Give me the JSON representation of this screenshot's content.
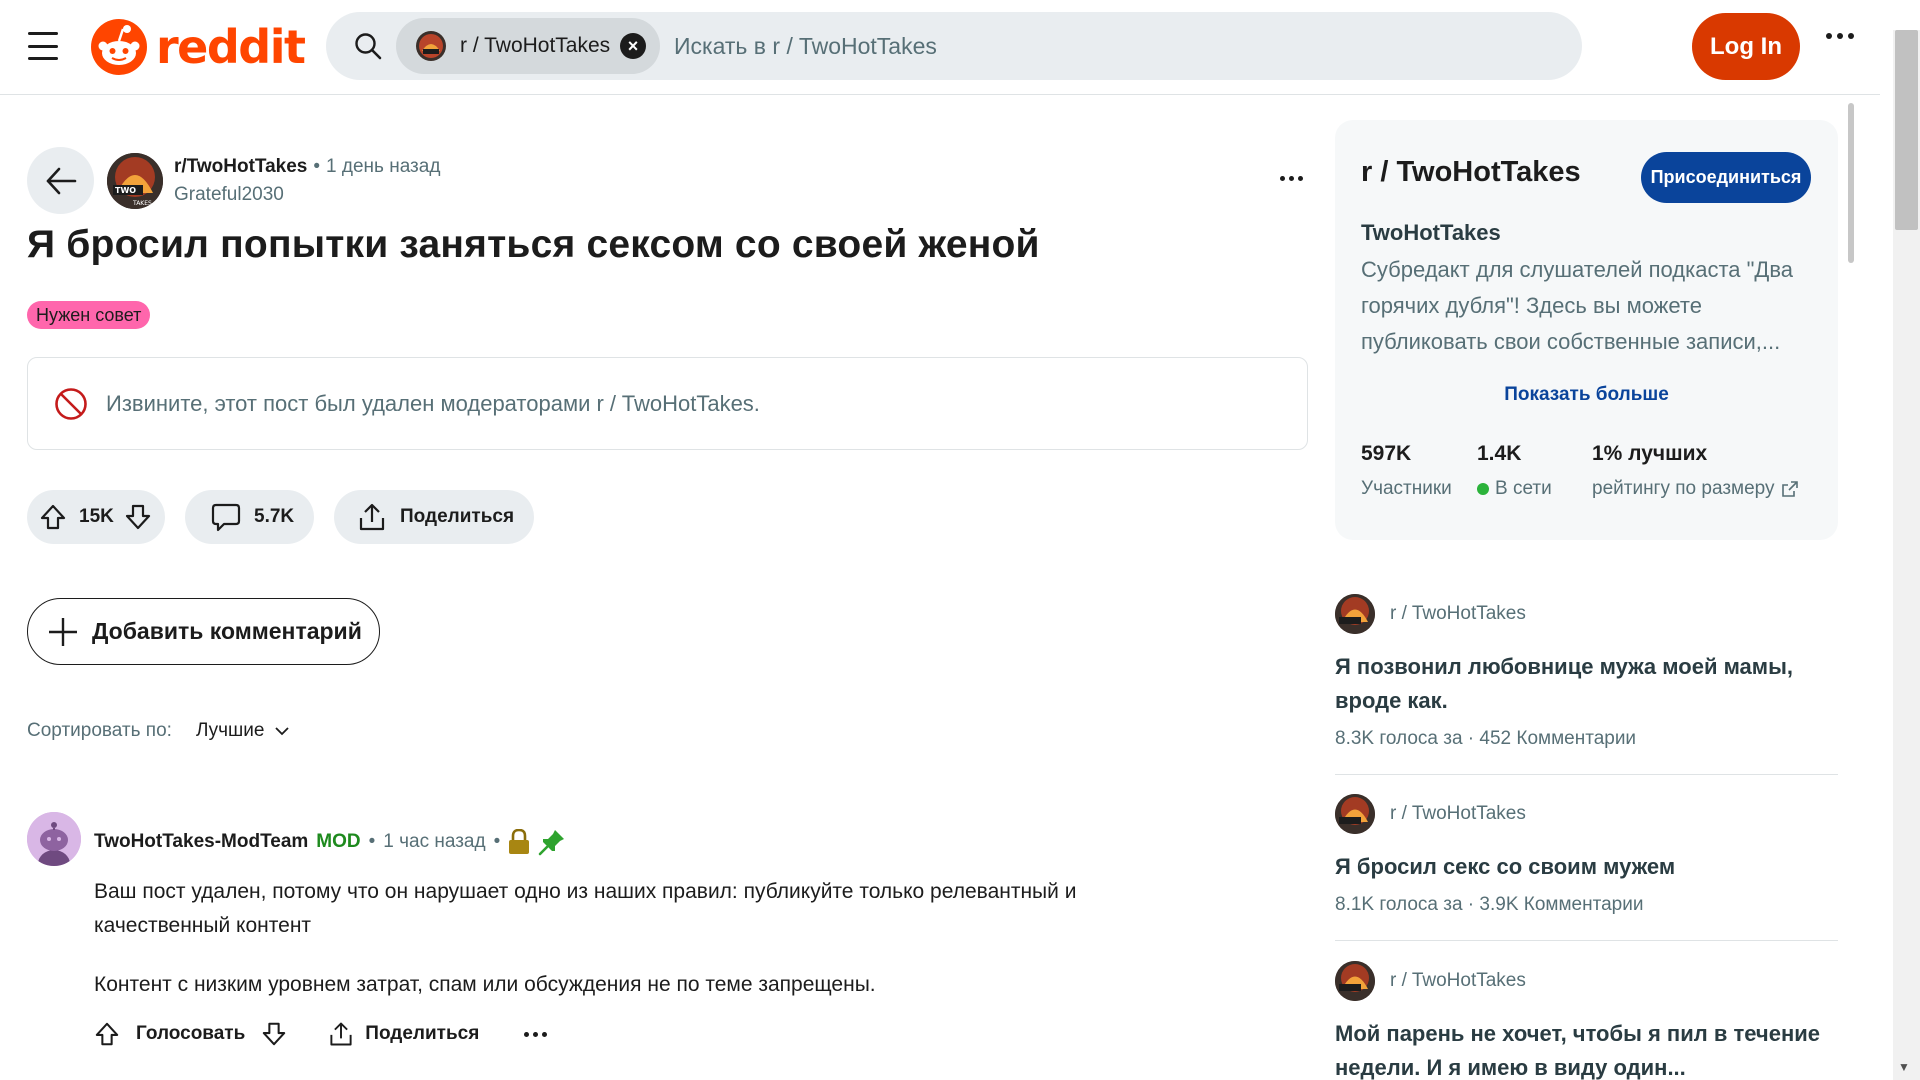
{
  "header": {
    "logo_text": "reddit",
    "search_chip_label": "r / TwoHotTakes",
    "search_placeholder": "Искать в r / TwoHotTakes",
    "login_label": "Log In"
  },
  "post": {
    "subreddit": "r/TwoHotTakes",
    "separator": "•",
    "time": "1 день назад",
    "author": "Grateful2030",
    "title": "Я бросил попытки заняться сексом со своей женой",
    "flair": "Нужен совет",
    "removed_message": "Извините, этот пост был удален модераторами r / TwoHotTakes.",
    "votes": "15K",
    "comments_count": "5.7K",
    "share_label": "Поделиться"
  },
  "comments_section": {
    "add_comment_label": "Добавить комментарий",
    "sort_label": "Сортировать по:",
    "sort_value": "Лучшие"
  },
  "comment": {
    "author": "TwoHotTakes-ModTeam",
    "badge": "MOD",
    "separator": "•",
    "time": "1 час назад",
    "body_1": "Ваш пост удален, потому что он нарушает одно из наших правил: публикуйте только релевантный и качественный контент",
    "body_2": "Контент с низким уровнем затрат, спам или обсуждения не по теме запрещены.",
    "vote_label": "Голосовать",
    "share_label": "Поделиться"
  },
  "sidebar": {
    "title": "r / TwoHotTakes",
    "join_label": "Присоединиться",
    "name": "TwoHotTakes",
    "description": "Субредакт для слушателей подкаста \"Два горячих дубля\"! Здесь вы можете публиковать свои собственные записи,...",
    "show_more": "Показать больше",
    "stats": [
      {
        "value": "597K",
        "label": "Участники"
      },
      {
        "value": "1.4K",
        "label": "В сети"
      },
      {
        "value": "1% лучших",
        "label": "рейтингу по размеру"
      }
    ]
  },
  "related_posts": [
    {
      "subreddit": "r / TwoHotTakes",
      "title": "Я позвонил любовнице мужа моей мамы, вроде как.",
      "meta": "8.3K голоса за  ·  452 Комментарии"
    },
    {
      "subreddit": "r / TwoHotTakes",
      "title": "Я бросил секс со своим мужем",
      "meta": "8.1K голоса за  ·  3.9K Комментарии"
    },
    {
      "subreddit": "r / TwoHotTakes",
      "title": "Мой парень не хочет, чтобы я пил в течение недели. И я имею в виду один...",
      "meta": ""
    }
  ],
  "colors": {
    "brand": "#ff4500",
    "login_bg": "#d93900",
    "join_bg": "#0a449b",
    "flair_bg": "#ff66ac",
    "mod_green": "#1e8a1e",
    "online": "#2bb33b"
  },
  "icons": [
    "menu-icon",
    "reddit-logo-icon",
    "search-icon",
    "close-icon",
    "more-icon",
    "back-arrow-icon",
    "ban-icon",
    "upvote-icon",
    "downvote-icon",
    "comment-icon",
    "share-icon",
    "plus-icon",
    "chevron-down-icon",
    "lock-icon",
    "pin-icon",
    "external-link-icon"
  ]
}
